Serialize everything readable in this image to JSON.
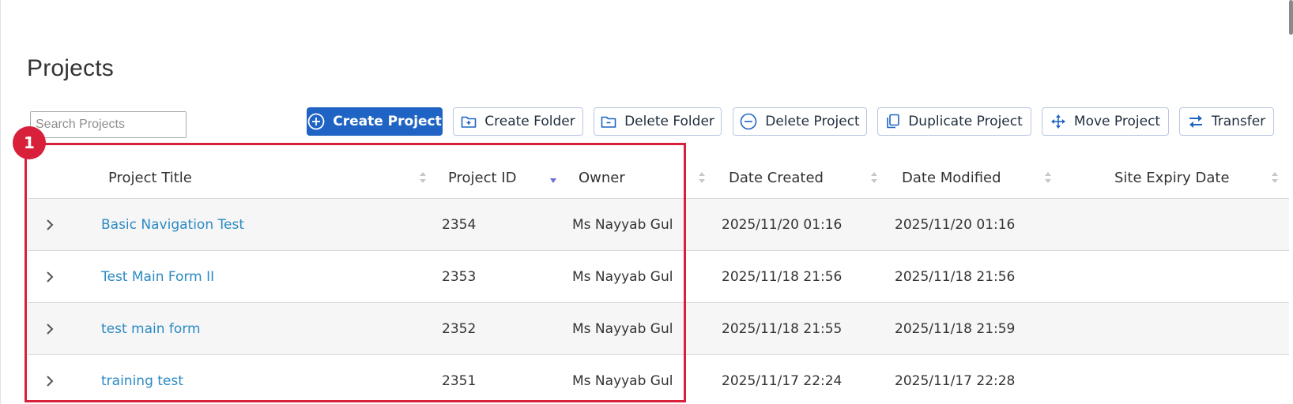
{
  "page": {
    "title": "Projects"
  },
  "search": {
    "placeholder": "Search Projects"
  },
  "toolbar": {
    "create_project": "Create Project",
    "create_folder": "Create Folder",
    "delete_folder": "Delete Folder",
    "delete_project": "Delete Project",
    "duplicate_project": "Duplicate Project",
    "move_project": "Move Project",
    "transfer": "Transfer"
  },
  "annotation": {
    "label": "1"
  },
  "table": {
    "columns": [
      "Project Title",
      "Project ID",
      "Owner",
      "Date Created",
      "Date Modified",
      "Site Expiry Date"
    ],
    "sorted_column": "Project ID",
    "sort_direction": "descending",
    "rows": [
      {
        "title": "Basic Navigation Test",
        "id": "2354",
        "owner": "Ms Nayyab Gul",
        "created": "2025/11/20 01:16",
        "modified": "2025/11/20 01:16",
        "expiry": ""
      },
      {
        "title": "Test Main Form II",
        "id": "2353",
        "owner": "Ms Nayyab Gul",
        "created": "2025/11/18 21:56",
        "modified": "2025/11/18 21:56",
        "expiry": ""
      },
      {
        "title": "test main form",
        "id": "2352",
        "owner": "Ms Nayyab Gul",
        "created": "2025/11/18 21:55",
        "modified": "2025/11/18 21:59",
        "expiry": ""
      },
      {
        "title": "training test",
        "id": "2351",
        "owner": "Ms Nayyab Gul",
        "created": "2025/11/17 22:24",
        "modified": "2025/11/17 22:28",
        "expiry": ""
      }
    ]
  },
  "colors": {
    "primary": "#1f63c4",
    "link": "#2b8ac4",
    "annotation": "#d8203a",
    "sort_active": "#6b6fd6"
  }
}
